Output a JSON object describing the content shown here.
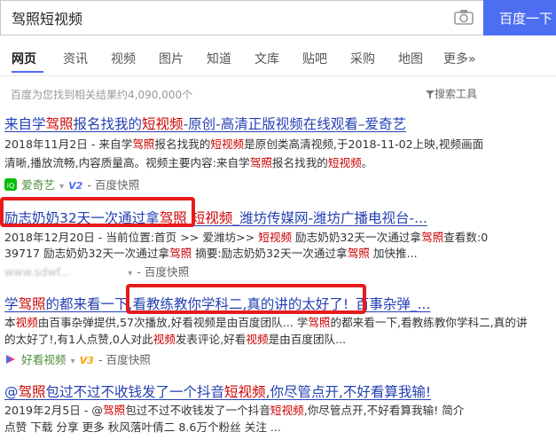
{
  "search": {
    "query": "驾照短视频",
    "button": "百度一下"
  },
  "tabs": [
    "网页",
    "资讯",
    "视频",
    "图片",
    "知道",
    "文库",
    "贴吧",
    "采购",
    "地图",
    "更多»"
  ],
  "result_count": "百度为您找到相关结果约4,090,000个",
  "search_tools": "搜索工具",
  "results": [
    {
      "title_a": "来自学",
      "title_hl1": "驾照",
      "title_b": "报名找我的",
      "title_hl2": "短视频",
      "title_c": "-原创-高清正版视频在线观看–爱奇艺",
      "line1_a": "2018年11月2日 - 来自学",
      "line1_hl1": "驾照",
      "line1_b": "报名找我的",
      "line1_hl2": "短视频",
      "line1_c": "是原创类高清视频,于2018-11-02上映,视频画面",
      "line2_a": "清晰,播放流畅,内容质量高。视频主要内容:来自学",
      "line2_hl": "驾照",
      "line2_b": "报名找我的",
      "line2_hl2": "短视频",
      "line2_c": "。",
      "source": "爱奇艺",
      "badge": "V2",
      "snapshot": "百度快照"
    },
    {
      "title_a": "励志奶奶32天一次通过拿",
      "title_hl1": "驾照",
      "title_b": " ",
      "title_hl2": "短视频",
      "title_c": "_潍坊传媒网-潍坊广播电视台-...",
      "line1": "2018年12月20日 - 当前位置:首页 >> 爱潍坊>> ",
      "line1_hl1": "短视频",
      "line1_b": " 励志奶奶32天一次通过拿",
      "line1_hl2": "驾照",
      "line1_c": "查看数:0",
      "line2_a": "39717 励志奶奶32天一次通过拿",
      "line2_hl": "驾照",
      "line2_b": " 摘要:励志奶奶32天一次通过拿",
      "line2_hl2": "驾照",
      "line2_c": " 加快推...",
      "source": "www.sdwf...",
      "snapshot": "百度快照"
    },
    {
      "title_a": "学",
      "title_hl1": "驾照",
      "title_b": "的都来看一下,",
      "title_c": "看教练教你学科二,真的讲的太好了!",
      "title_d": "_百事杂弹_...",
      "line1_a": "本",
      "line1_hl": "视频",
      "line1_b": "由百事杂弹提供,57次播放,好看视频是由百度团队... 学",
      "line1_hl2": "驾照",
      "line1_c": "的都来看一下,看教练教你学科二,真的讲",
      "line2_a": "的太好了!,有1人点赞,0人对此",
      "line2_hl": "视频",
      "line2_b": "发表评论,好看",
      "line2_hl2": "视频",
      "line2_c": "是由百度团队...",
      "source": "好看视频",
      "badge": "V3",
      "snapshot": "百度快照"
    },
    {
      "title_a": "@",
      "title_hl1": "驾照",
      "title_b": "包过不过不收钱发了一个抖音",
      "title_hl2": "短视频",
      "title_c": ",你尽管点开,不好看算我输!",
      "line1_a": "2019年2月5日 - @",
      "line1_hl": "驾照",
      "line1_b": "包过不过不收钱发了一个抖音",
      "line1_hl2": "短视频",
      "line1_c": ",你尽管点开,不好看算我输! 简介",
      "line2": "点赞 下载 分享 更多 秋风落叶倩二 8.6万个粉丝 关注 ..."
    }
  ],
  "colors": {
    "accent": "#4e6ef2",
    "link": "#2440b3",
    "highlight": "#c00",
    "annotation": "#e61c1c"
  }
}
